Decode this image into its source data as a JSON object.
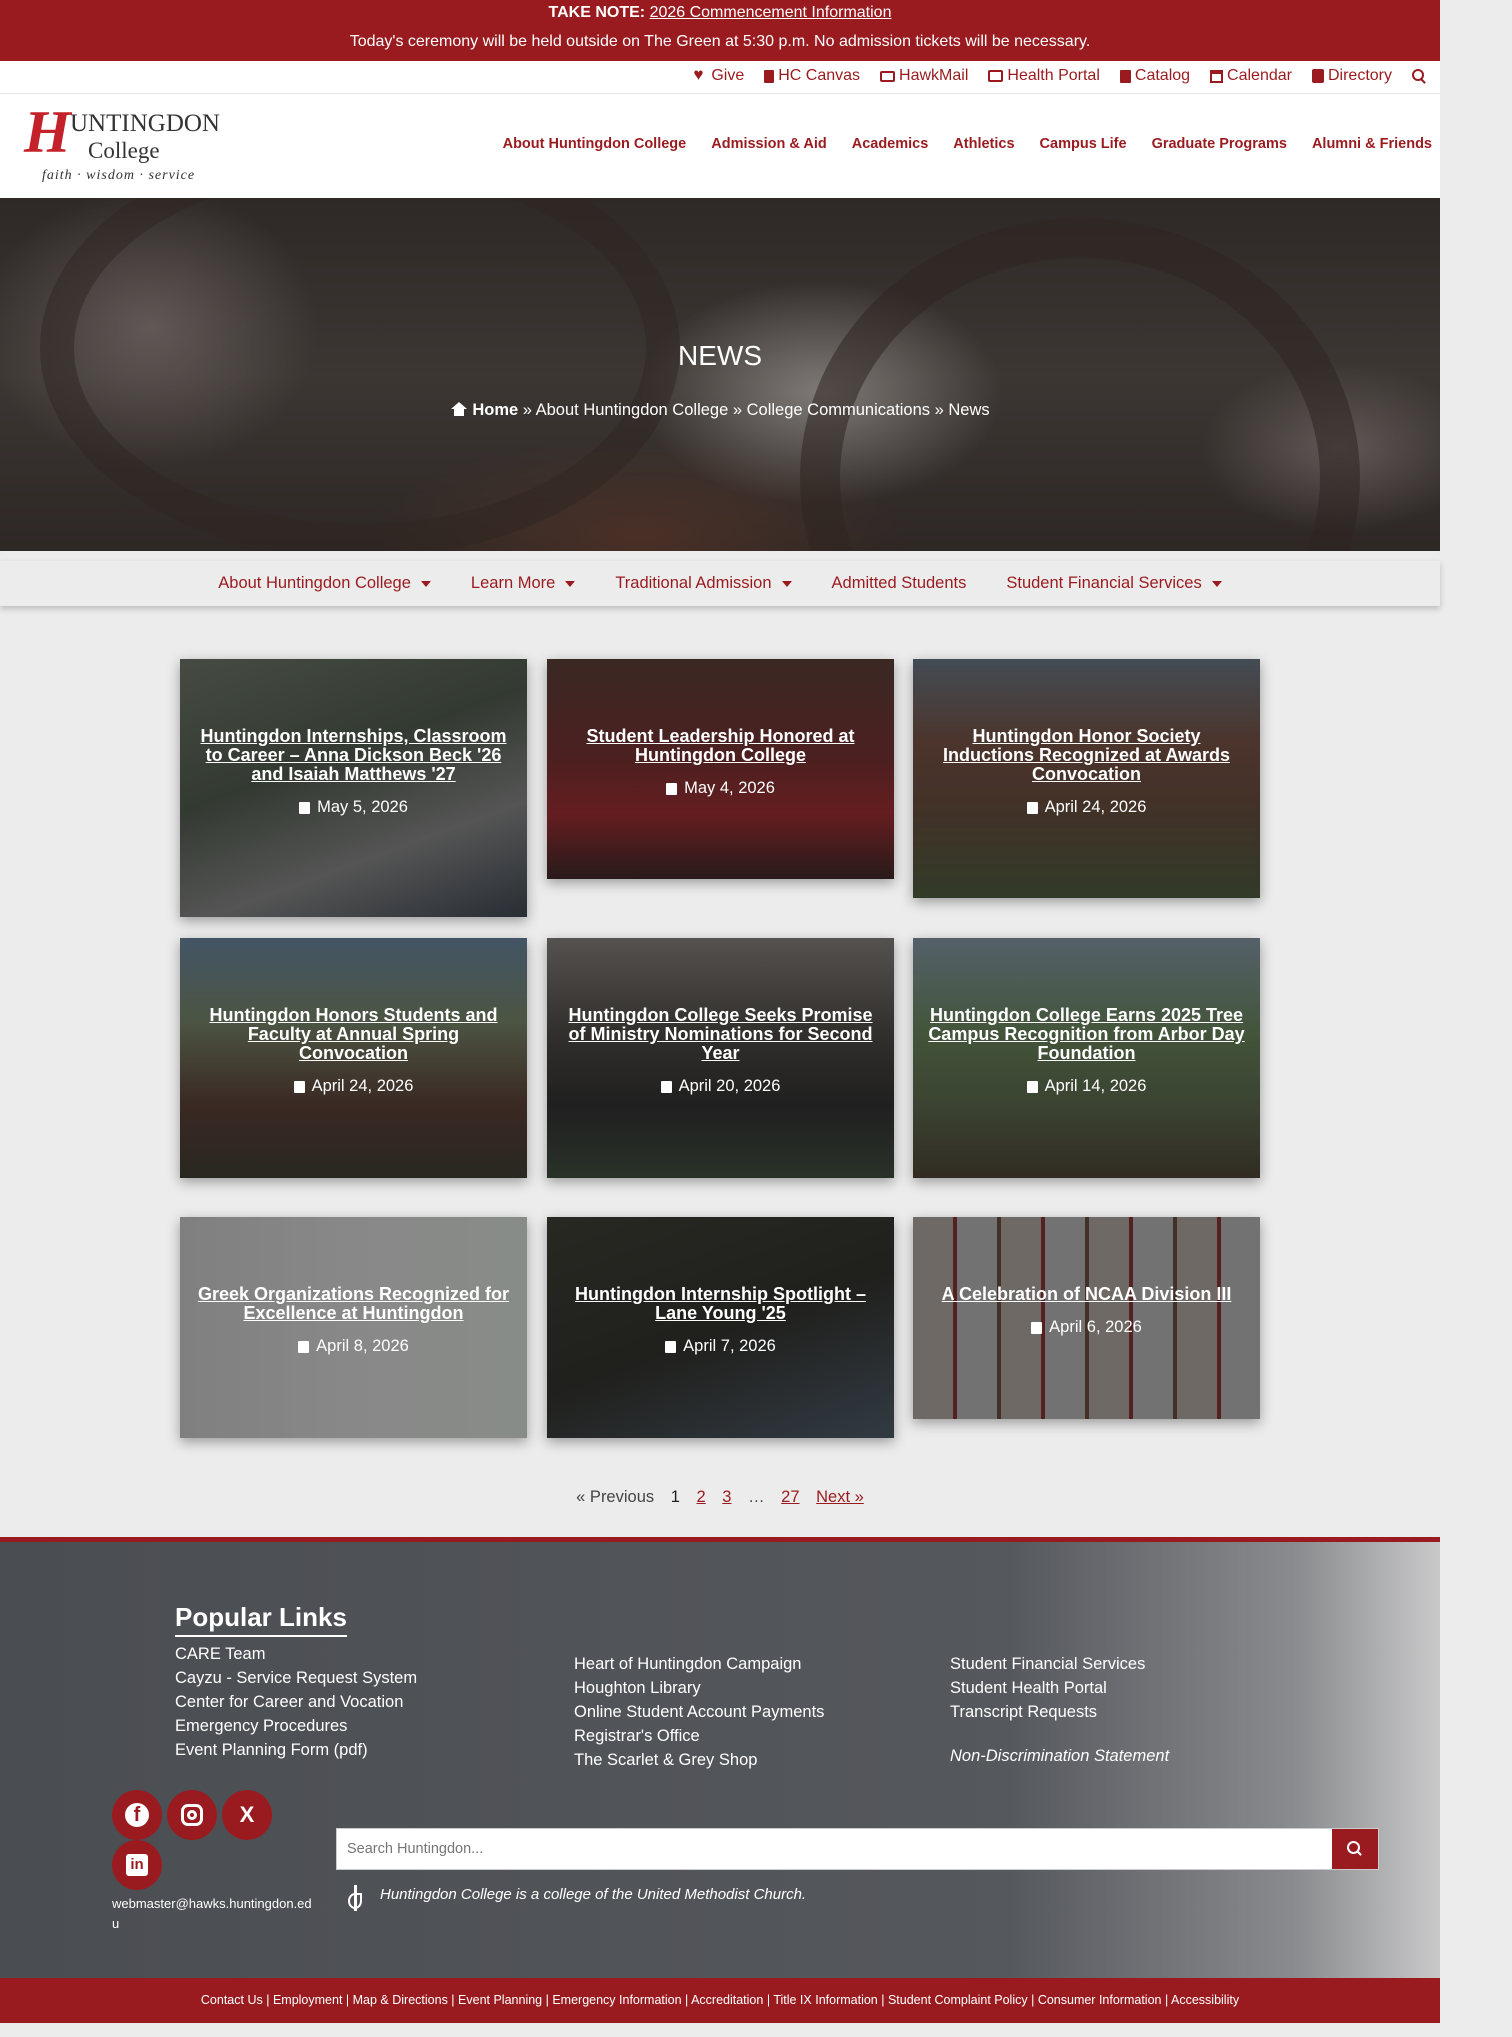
{
  "announcement": {
    "label": "TAKE NOTE:",
    "link": "2026 Commencement Information",
    "message": "Today's ceremony will be held outside on The Green at 5:30 p.m. No admission tickets will be necessary."
  },
  "utility_links": [
    {
      "label": "Give",
      "icon": "heart-icon"
    },
    {
      "label": "HC Canvas",
      "icon": "bookmark-icon"
    },
    {
      "label": "HawkMail",
      "icon": "envelope-icon"
    },
    {
      "label": "Health Portal",
      "icon": "medkit-icon"
    },
    {
      "label": "Catalog",
      "icon": "book-icon"
    },
    {
      "label": "Calendar",
      "icon": "calendar-icon"
    },
    {
      "label": "Directory",
      "icon": "id-card-icon"
    }
  ],
  "logo": {
    "initial": "H",
    "line1": "UNTINGDON",
    "line2": "College",
    "tagline": "faith · wisdom · service"
  },
  "main_nav": [
    "About Huntingdon College",
    "Admission & Aid",
    "Academics",
    "Athletics",
    "Campus Life",
    "Graduate Programs",
    "Alumni & Friends"
  ],
  "hero": {
    "title": "NEWS",
    "breadcrumb_home": "Home",
    "breadcrumb_rest": " » About Huntingdon College » College Communications » News"
  },
  "sub_nav": [
    {
      "label": "About Huntingdon College",
      "dropdown": true
    },
    {
      "label": "Learn More",
      "dropdown": true
    },
    {
      "label": "Traditional Admission",
      "dropdown": true
    },
    {
      "label": "Admitted Students",
      "dropdown": false
    },
    {
      "label": "Student Financial Services",
      "dropdown": true
    }
  ],
  "news": [
    {
      "title": "Huntingdon Internships, Classroom to Career – Anna Dickson Beck '26 and Isaiah Matthews '27",
      "date": "May 5, 2026"
    },
    {
      "title": "Student Leadership Honored at Huntingdon College",
      "date": "May 4, 2026"
    },
    {
      "title": "Huntingdon Honor Society Inductions Recognized at Awards Convocation",
      "date": "April 24, 2026"
    },
    {
      "title": "Huntingdon Honors Students and Faculty at Annual Spring Convocation",
      "date": "April 24, 2026"
    },
    {
      "title": "Huntingdon College Seeks Promise of Ministry Nominations for Second Year",
      "date": "April 20, 2026"
    },
    {
      "title": "Huntingdon College Earns 2025 Tree Campus Recognition from Arbor Day Foundation",
      "date": "April 14, 2026"
    },
    {
      "title": "Greek Organizations Recognized for Excellence at Huntingdon",
      "date": "April 8, 2026"
    },
    {
      "title": "Huntingdon Internship Spotlight – Lane Young '25",
      "date": "April 7, 2026"
    },
    {
      "title": "A Celebration of NCAA Division III",
      "date": "April 6, 2026"
    }
  ],
  "pagination": {
    "prev": "« Previous",
    "current": "1",
    "pages": [
      "2",
      "3"
    ],
    "ellipsis": "…",
    "last": "27",
    "next": "Next »"
  },
  "footer": {
    "heading": "Popular Links",
    "col1": [
      "CARE Team",
      "Cayzu - Service Request System",
      "Center for Career and Vocation",
      "Emergency Procedures",
      "Event Planning Form (pdf)"
    ],
    "col2": [
      "Heart of Huntingdon Campaign",
      "Houghton Library",
      "Online Student Account Payments",
      "Registrar's Office",
      "The Scarlet & Grey Shop"
    ],
    "col3": [
      "Student Financial Services",
      "Student Health Portal",
      "Transcript Requests"
    ],
    "non_discrimination": "Non-Discrimination Statement",
    "email": "webmaster@hawks.huntingdon.edu",
    "search_placeholder": "Search Huntingdon...",
    "methodist": "Huntingdon College is a college of the United Methodist Church.",
    "social": {
      "x_label": "X",
      "linkedin_label": "in",
      "facebook_label": "f"
    }
  },
  "bottom_links": [
    "Contact Us",
    "Employment",
    "Map & Directions",
    "Event Planning",
    "Emergency Information",
    "Accreditation",
    "Title IX Information",
    "Student Complaint Policy",
    "Consumer Information",
    "Accessibility"
  ],
  "colors": {
    "brand": "#9a1b1f",
    "footer_bg": "#55585d"
  }
}
